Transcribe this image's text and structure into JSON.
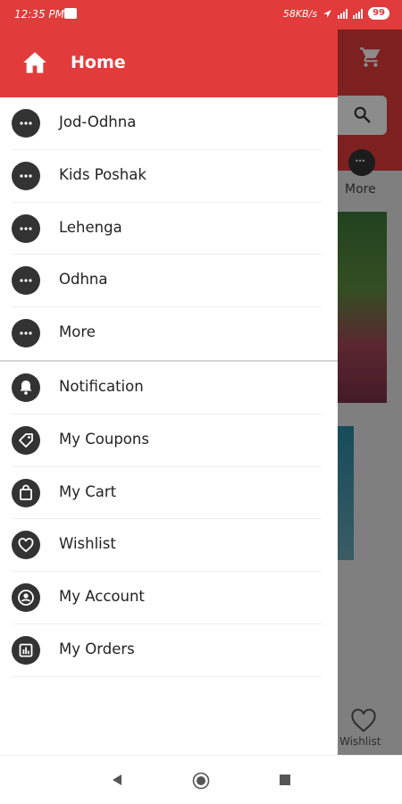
{
  "status_bar": {
    "time": "12:35 PM",
    "network": "58KB/s",
    "battery": "99"
  },
  "drawer": {
    "header": {
      "title": "Home",
      "icon": "home-icon"
    },
    "categories": [
      {
        "label": "Jod-Odhna",
        "icon": "more-dots-icon"
      },
      {
        "label": "Kids Poshak",
        "icon": "more-dots-icon"
      },
      {
        "label": "Lehenga",
        "icon": "more-dots-icon"
      },
      {
        "label": "Odhna",
        "icon": "more-dots-icon"
      },
      {
        "label": "More",
        "icon": "more-dots-icon"
      }
    ],
    "account_items": [
      {
        "label": "Notification",
        "icon": "bell-icon"
      },
      {
        "label": "My Coupons",
        "icon": "tag-icon"
      },
      {
        "label": "My Cart",
        "icon": "bag-icon"
      },
      {
        "label": "Wishlist",
        "icon": "heart-icon"
      },
      {
        "label": "My Account",
        "icon": "account-icon"
      },
      {
        "label": "My Orders",
        "icon": "orders-icon"
      }
    ]
  },
  "background_app": {
    "more_label": "More",
    "wishlist_label": "Wishlist"
  },
  "colors": {
    "accent": "#e23b3b",
    "icon_dark": "#333333"
  }
}
